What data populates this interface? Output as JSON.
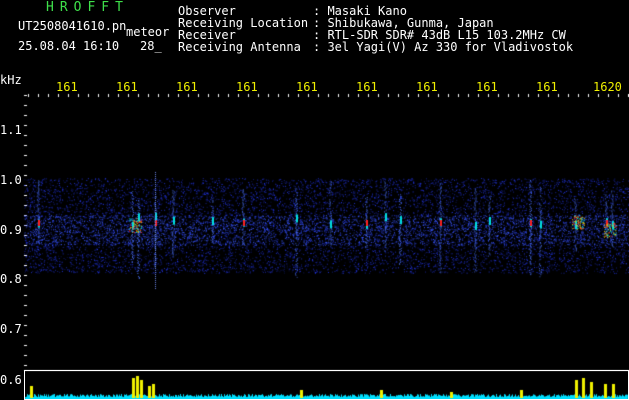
{
  "header": {
    "brand": "HROFFT",
    "filename": "UT2508041610.pn",
    "mode": "meteor",
    "datetime": "25.08.04 16:10",
    "counter": "28_",
    "labels": {
      "observer": "Observer",
      "location": "Receiving Location",
      "receiver": "Receiver",
      "antenna": "Receiving Antenna"
    },
    "values": {
      "observer": ": Masaki Kano",
      "location": ": Shibukawa, Gunma, Japan",
      "receiver": ": RTL-SDR SDR# 43dB L15 103.2MHz CW",
      "antenna": ": 3el Yagi(V) Az 330 for Vladivostok"
    }
  },
  "axis": {
    "unit": "kHz",
    "y_ticks": [
      "1.1",
      "1.0",
      "0.9",
      "0.8",
      "0.7",
      "0.6"
    ],
    "time_ticks": [
      "161",
      "161",
      "161",
      "161",
      "161",
      "161",
      "161",
      "161",
      "161",
      "1620"
    ]
  },
  "colors": {
    "background": "#000000",
    "text": "#ffffff",
    "brand": "#3ee04a",
    "time_label": "#f0f000",
    "signal_low": "#1a2cff",
    "signal_mid": "#00e0e0",
    "signal_high": "#ff2020",
    "power_bar": "#f0f000",
    "power_base": "#00e0ff"
  }
}
